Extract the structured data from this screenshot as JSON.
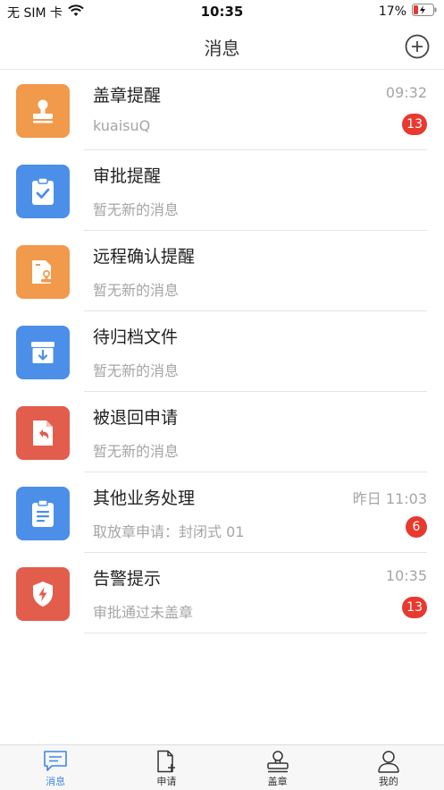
{
  "status_bar": {
    "carrier": "无 SIM 卡",
    "time": "10:35",
    "battery": "17%"
  },
  "nav": {
    "title": "消息"
  },
  "colors": {
    "orange": "#f19a4b",
    "blue": "#4b8fe8",
    "red": "#e35d4c",
    "badge": "#e8392f",
    "active_tab": "#3f87e6"
  },
  "messages": [
    {
      "title": "盖章提醒",
      "subtitle": "kuaisuQ",
      "time": "09:32",
      "badge": "13",
      "icon": "stamp-icon",
      "color": "orange"
    },
    {
      "title": "审批提醒",
      "subtitle": "暂无新的消息",
      "time": "",
      "badge": "",
      "icon": "clipboard-check-icon",
      "color": "blue"
    },
    {
      "title": "远程确认提醒",
      "subtitle": "暂无新的消息",
      "time": "",
      "badge": "",
      "icon": "remote-confirm-icon",
      "color": "orange"
    },
    {
      "title": "待归档文件",
      "subtitle": "暂无新的消息",
      "time": "",
      "badge": "",
      "icon": "archive-box-icon",
      "color": "blue"
    },
    {
      "title": "被退回申请",
      "subtitle": "暂无新的消息",
      "time": "",
      "badge": "",
      "icon": "returned-document-icon",
      "color": "red"
    },
    {
      "title": "其他业务处理",
      "subtitle": "取放章申请：封闭式 01",
      "time": "昨日 11:03",
      "badge": "6",
      "icon": "clipboard-list-icon",
      "color": "blue"
    },
    {
      "title": "告警提示",
      "subtitle": "审批通过未盖章",
      "time": "10:35",
      "badge": "13",
      "icon": "alert-shield-icon",
      "color": "red"
    }
  ],
  "tabs": [
    {
      "label": "消息",
      "icon": "message-icon",
      "active": true
    },
    {
      "label": "申请",
      "icon": "document-add-icon",
      "active": false
    },
    {
      "label": "盖章",
      "icon": "stamp-tab-icon",
      "active": false
    },
    {
      "label": "我的",
      "icon": "user-icon",
      "active": false
    }
  ]
}
